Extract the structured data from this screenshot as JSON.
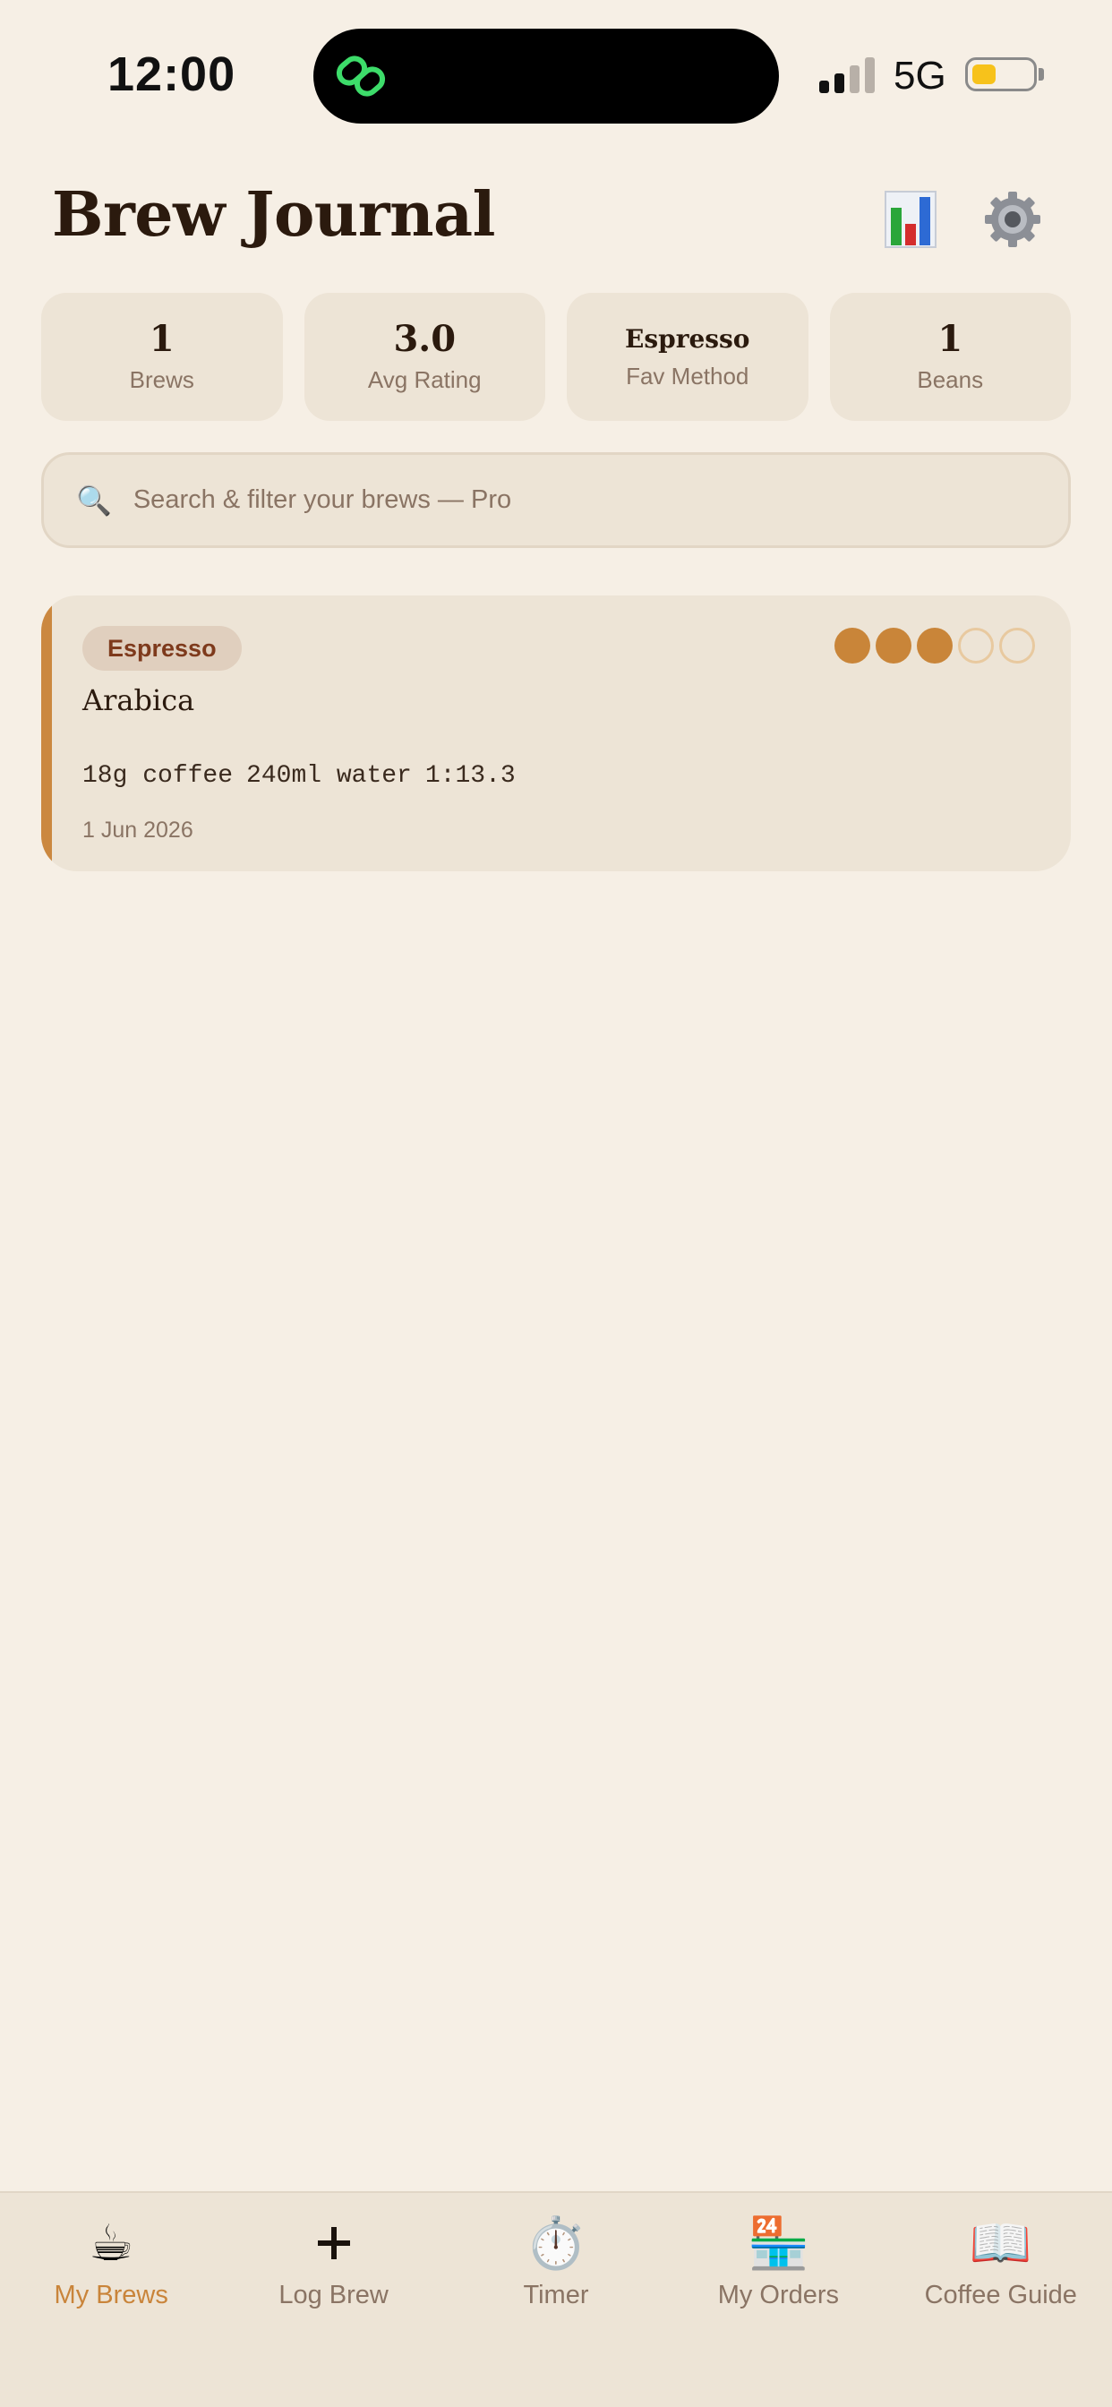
{
  "status_bar": {
    "time": "12:00",
    "network": "5G",
    "battery_level": 0.3,
    "battery_color": "#f7c21b",
    "activity_icon": "link-icon"
  },
  "header": {
    "title": "Brew Journal",
    "stats_icon": "bar-chart-icon",
    "settings_icon": "gear-icon"
  },
  "stats": [
    {
      "value": "1",
      "label": "Brews"
    },
    {
      "value": "3.0",
      "label": "Avg Rating"
    },
    {
      "value": "Espresso",
      "label": "Fav Method"
    },
    {
      "value": "1",
      "label": "Beans"
    }
  ],
  "search": {
    "icon": "magnifier-icon",
    "placeholder": "Search & filter your brews — Pro"
  },
  "brews": [
    {
      "method": "Espresso",
      "bean": "Arabica",
      "rating": 3,
      "rating_max": 5,
      "coffee": "18g coffee",
      "water": "240ml water",
      "ratio": "1:13.3",
      "date": "1 Jun 2026",
      "accent_color": "#cb8840"
    }
  ],
  "tabs": [
    {
      "label": "My Brews",
      "icon": "coffee-cup-icon",
      "active": true
    },
    {
      "label": "Log Brew",
      "icon": "plus-icon",
      "active": false
    },
    {
      "label": "Timer",
      "icon": "stopwatch-icon",
      "active": false
    },
    {
      "label": "My Orders",
      "icon": "store-icon",
      "active": false
    },
    {
      "label": "Coffee Guide",
      "icon": "open-book-icon",
      "active": false
    }
  ],
  "colors": {
    "background": "#f6efe5",
    "card": "#ede4d6",
    "accent": "#c9843a",
    "text_dark": "#2b1a0e",
    "text_muted": "#8a7464"
  }
}
